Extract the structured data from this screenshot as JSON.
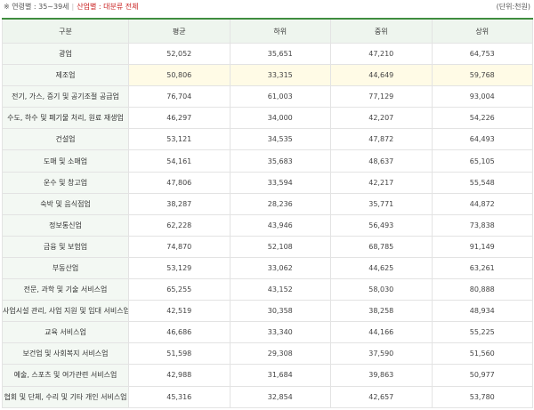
{
  "filter": {
    "age_label": "※ 연령별 : 35~39세",
    "separator": "|",
    "industry_label": "산업별 : 대분류 전체"
  },
  "unit_label": "(단위:천원)",
  "table": {
    "headers": [
      "구분",
      "평균",
      "하위",
      "중위",
      "상위"
    ],
    "rows": [
      {
        "category": "광업",
        "values": [
          "52,052",
          "35,651",
          "47,210",
          "64,753"
        ]
      },
      {
        "category": "제조업",
        "values": [
          "50,806",
          "33,315",
          "44,649",
          "59,768"
        ],
        "highlighted": true
      },
      {
        "category": "전기, 가스, 증기 및 공기조절 공급업",
        "values": [
          "76,704",
          "61,003",
          "77,129",
          "93,004"
        ]
      },
      {
        "category": "수도, 하수 및 폐기물 처리, 원료 재생업",
        "values": [
          "46,297",
          "34,000",
          "42,207",
          "54,226"
        ]
      },
      {
        "category": "건설업",
        "values": [
          "53,121",
          "34,535",
          "47,872",
          "64,493"
        ]
      },
      {
        "category": "도매 및 소매업",
        "values": [
          "54,161",
          "35,683",
          "48,637",
          "65,105"
        ]
      },
      {
        "category": "운수 및 창고업",
        "values": [
          "47,806",
          "33,594",
          "42,217",
          "55,548"
        ]
      },
      {
        "category": "숙박 및 음식점업",
        "values": [
          "38,287",
          "28,236",
          "35,771",
          "44,872"
        ]
      },
      {
        "category": "정보통신업",
        "values": [
          "62,228",
          "43,946",
          "56,493",
          "73,838"
        ]
      },
      {
        "category": "금융 및 보험업",
        "values": [
          "74,870",
          "52,108",
          "68,785",
          "91,149"
        ]
      },
      {
        "category": "부동산업",
        "values": [
          "53,129",
          "33,062",
          "44,625",
          "63,261"
        ]
      },
      {
        "category": "전문, 과학 및 기술 서비스업",
        "values": [
          "65,255",
          "43,152",
          "58,030",
          "80,888"
        ]
      },
      {
        "category": "사업시설 관리, 사업 지원 및 임대 서비스업",
        "values": [
          "42,519",
          "30,358",
          "38,258",
          "48,934"
        ]
      },
      {
        "category": "교육 서비스업",
        "values": [
          "46,686",
          "33,340",
          "44,166",
          "55,225"
        ]
      },
      {
        "category": "보건업 및 사회복지 서비스업",
        "values": [
          "51,598",
          "29,308",
          "37,590",
          "51,560"
        ]
      },
      {
        "category": "예술, 스포츠 및 여가관련 서비스업",
        "values": [
          "42,988",
          "31,684",
          "39,863",
          "50,977"
        ]
      },
      {
        "category": "협회 및 단체, 수리 및 기타 개인 서비스업",
        "values": [
          "45,316",
          "32,854",
          "42,657",
          "53,780"
        ]
      }
    ]
  }
}
